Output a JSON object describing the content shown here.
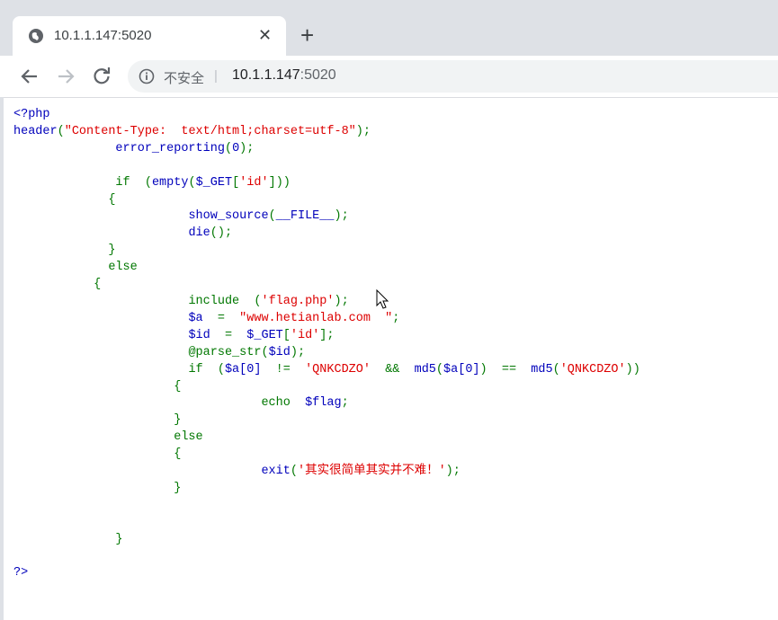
{
  "tab": {
    "title": "10.1.1.147:5020",
    "close": "✕",
    "new_tab": "+"
  },
  "omnibox": {
    "security_label": "不安全",
    "separator": "|",
    "host": "10.1.1.147",
    "port": ":5020"
  },
  "icons": [
    "globe-icon",
    "back-arrow-icon",
    "forward-arrow-icon",
    "reload-icon",
    "info-icon",
    "mouse-cursor-icon"
  ],
  "source": {
    "open": "<?php",
    "header_fn": "header",
    "header_arg": "\"Content-Type:  text/html;charset=utf-8\"",
    "error_reporting": "error_reporting",
    "zero": "0",
    "if1": "if",
    "empty": "empty",
    "get1": "$_GET",
    "id_key1": "'id'",
    "brace": "{",
    "brace_close": "}",
    "show_source": "show_source",
    "file_const": "__FILE__",
    "die": "die",
    "else": "else",
    "include": "include",
    "flag_file": "'flag.php'",
    "var_a": "$a",
    "host_str": "\"www.hetianlab.com  \"",
    "var_id": "$id",
    "get2": "$_GET",
    "id_key2": "'id'",
    "parse_str": "@parse_str",
    "var_id2": "$id",
    "if2": "if",
    "a0": "$a[0]",
    "neq": "!=",
    "qnk1": "'QNKCDZO'",
    "and": "&&",
    "md5a": "md5",
    "a0b": "$a[0]",
    "eq": "==",
    "md5b": "md5",
    "qnk2": "'QNKCDZO'",
    "echo": "echo",
    "flag_var": "$flag",
    "exit": "exit",
    "exit_msg": "'其实很简单其实并不难！'",
    "close_tag": "?>"
  }
}
